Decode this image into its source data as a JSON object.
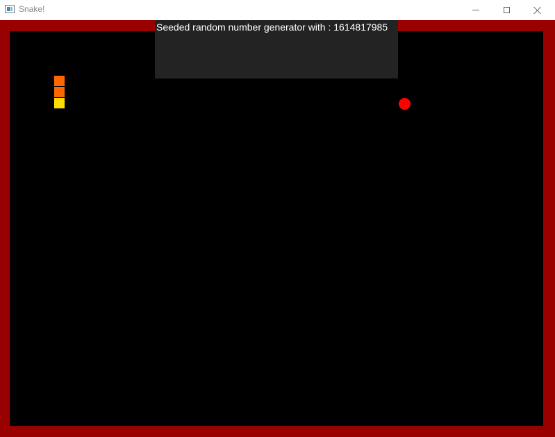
{
  "window": {
    "title": "Snake!",
    "icon": "app-window-icon",
    "controls": [
      "minimize-icon",
      "maximize-icon",
      "close-icon"
    ]
  },
  "game": {
    "console_text": "Seeded random number generator with : 1614817985",
    "colors": {
      "border": "#990000",
      "field": "#000000",
      "console_bg": "#232323",
      "snake_body": "#ff6600",
      "snake_head": "#ffdd00",
      "food": "#ff0000"
    },
    "snake": {
      "segments": [
        "body",
        "body",
        "head"
      ]
    },
    "food": {
      "shape": "circle"
    }
  }
}
